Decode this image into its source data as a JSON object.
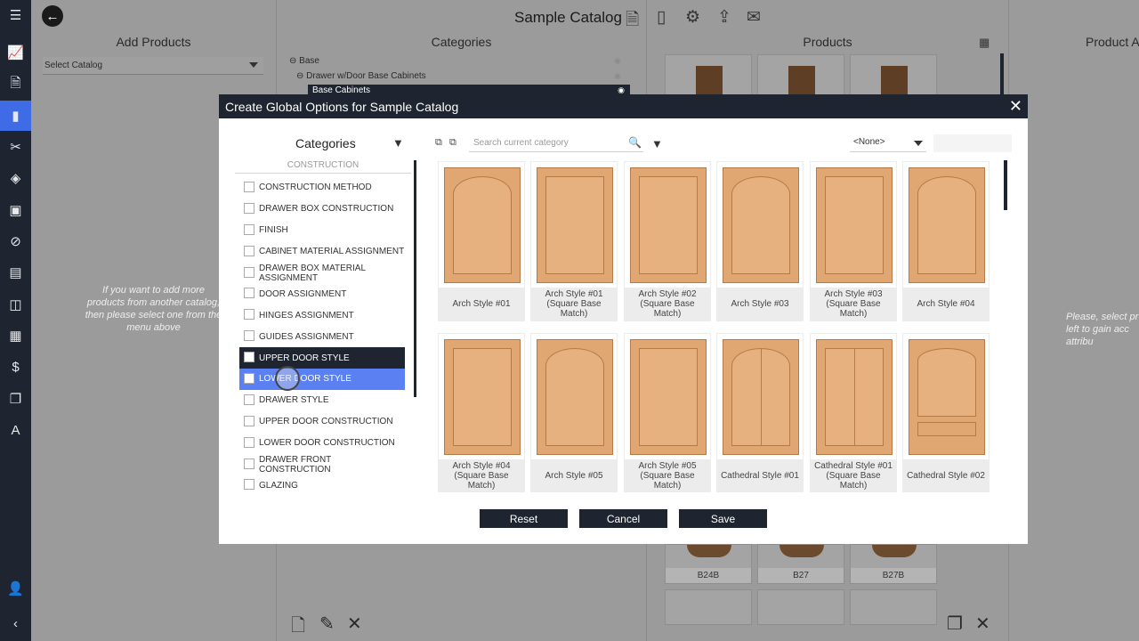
{
  "app": {
    "title": "Sample Catalog",
    "columns": {
      "add_products": "Add Products",
      "categories": "Categories",
      "products": "Products",
      "product_attr": "Product At"
    },
    "select_catalog": "Select Catalog",
    "tree": {
      "base": "Base",
      "drawer_door": "Drawer w/Door Base Cabinets",
      "base_cabinets": "Base Cabinets"
    },
    "hint_left": "If you want to add more products from another catalog, then please select one from the menu above",
    "hint_right": "Please, select pr left to gain acc attribu",
    "bottom_products": [
      "B24B",
      "B27",
      "B27B"
    ]
  },
  "nav_icons": [
    "menu-icon",
    "chart-icon",
    "document-icon",
    "catalog-icon",
    "tools-icon",
    "layers-icon",
    "box-icon",
    "rulers-icon",
    "book-icon",
    "layout-icon",
    "grid-icon",
    "dollar-icon",
    "pages-icon",
    "text-icon",
    "user-icon",
    "back-icon"
  ],
  "modal": {
    "title": "Create Global Options for Sample Catalog",
    "categories_title": "Categories",
    "section": "CONSTRUCTION",
    "options": [
      "CONSTRUCTION METHOD",
      "DRAWER BOX CONSTRUCTION",
      "FINISH",
      "CABINET MATERIAL ASSIGNMENT",
      "DRAWER BOX MATERIAL ASSIGNMENT",
      "DOOR ASSIGNMENT",
      "HINGES ASSIGNMENT",
      "GUIDES ASSIGNMENT",
      "UPPER DOOR STYLE",
      "LOWER DOOR STYLE",
      "DRAWER STYLE",
      "UPPER DOOR CONSTRUCTION",
      "LOWER DOOR CONSTRUCTION",
      "DRAWER FRONT CONSTRUCTION",
      "GLAZING"
    ],
    "selected_option": "UPPER DOOR STYLE",
    "hovered_option": "LOWER DOOR STYLE",
    "search_placeholder": "Search current category",
    "none_select": "<None>",
    "items": [
      "Arch Style #01",
      "Arch Style #01 (Square Base Match)",
      "Arch Style #02 (Square Base Match)",
      "Arch Style #03",
      "Arch Style #03 (Square Base Match)",
      "Arch Style #04",
      "Arch Style #04 (Square Base Match)",
      "Arch Style #05",
      "Arch Style #05 (Square Base Match)",
      "Cathedral Style #01",
      "Cathedral Style #01 (Square Base Match)",
      "Cathedral Style #02"
    ],
    "buttons": {
      "reset": "Reset",
      "cancel": "Cancel",
      "save": "Save"
    }
  },
  "colors": {
    "dark": "#1e2530",
    "accent": "#3f6ce6",
    "hover": "#5b80f2",
    "wood": "#e0a773"
  }
}
